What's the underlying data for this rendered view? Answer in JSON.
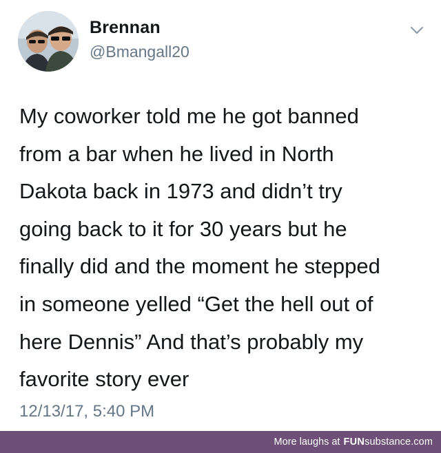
{
  "tweet": {
    "author_name": "Brennan",
    "author_handle": "@Bmangall20",
    "body_lines": [
      "My coworker told me he got banned",
      "from a bar when he lived in North",
      "Dakota back in 1973 and didn’t try",
      "going back to it for 30 years but he",
      "finally did and the moment he stepped",
      "in someone yelled “Get the hell out of",
      "here Dennis” And that’s probably my",
      "favorite story ever"
    ],
    "timestamp": "12/13/17, 5:40 PM",
    "menu_icon": "chevron-down-icon",
    "avatar_icon": "profile-photo"
  },
  "footer": {
    "prefix": "More laughs at",
    "brand_bold": "FUN",
    "brand_rest": "substance.com"
  },
  "colors": {
    "text_primary": "#14171a",
    "text_secondary": "#657786",
    "footer_bg": "#6e4f77",
    "footer_text": "#ffffff"
  }
}
